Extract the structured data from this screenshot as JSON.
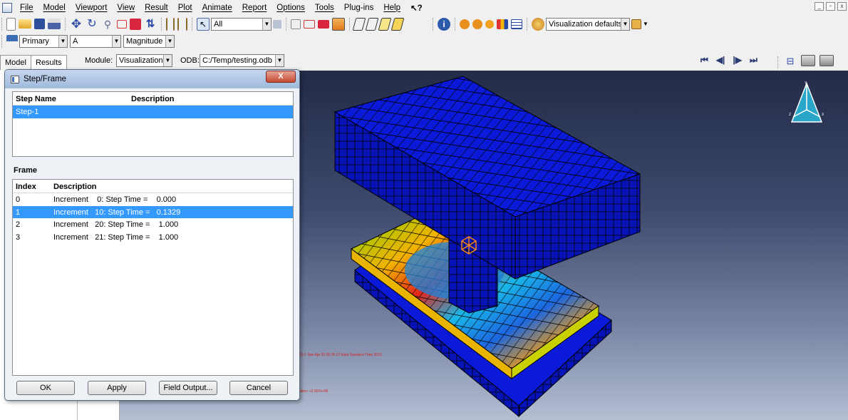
{
  "menu": [
    "File",
    "Model",
    "Viewport",
    "View",
    "Result",
    "Plot",
    "Animate",
    "Report",
    "Options",
    "Tools",
    "Plug-ins",
    "Help",
    "↖?"
  ],
  "toolbar": {
    "selection_filter": "All",
    "render_style": "Visualization defaults",
    "field_category": "Primary",
    "field_variable": "A",
    "field_invariant": "Magnitude"
  },
  "tabs": {
    "model": "Model",
    "results": "Results"
  },
  "module_row": {
    "module_label": "Module:",
    "module_value": "Visualization",
    "odb_label": "ODB:",
    "odb_value": "C:/Temp/testing.odb"
  },
  "dialog": {
    "title": "Step/Frame",
    "close": "X",
    "step_headers": {
      "name": "Step Name",
      "description": "Description"
    },
    "steps": [
      {
        "name": "Step-1",
        "description": "",
        "selected": true
      }
    ],
    "frame_label": "Frame",
    "frame_headers": {
      "index": "Index",
      "description": "Description"
    },
    "frames": [
      {
        "index": "0",
        "description": "Increment    0: Step Time =    0.000",
        "selected": false
      },
      {
        "index": "1",
        "description": "Increment   10: Step Time =   0.1329",
        "selected": true
      },
      {
        "index": "2",
        "description": "Increment   20: Step Time =    1.000",
        "selected": false
      },
      {
        "index": "3",
        "description": "Increment   21: Step Time =    1.000",
        "selected": false
      }
    ],
    "buttons": {
      "ok": "OK",
      "apply": "Apply",
      "field_output": "Field Output...",
      "cancel": "Cancel"
    }
  },
  "viewport": {
    "status_line": "10-1   Sun Apr 01 00:26:12 India Standard Time 2012",
    "factor_line": "ation:  +2.207e+06"
  },
  "colors": {
    "mesh_top": "#0a1ad8",
    "selection_blue": "#3399ff",
    "triad_cyan": "#2aa7c8"
  }
}
